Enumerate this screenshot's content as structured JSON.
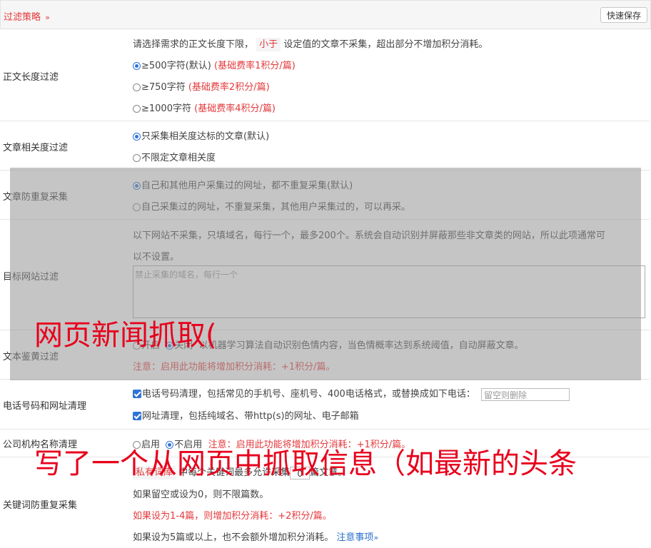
{
  "header": {
    "title": "过滤策略",
    "chevron": "»",
    "save_label": "快速保存"
  },
  "length_filter": {
    "label": "正文长度过滤",
    "desc_before": "请选择需求的正文长度下限，",
    "desc_tag": "小于",
    "desc_after": "设定值的文章不采集，超出部分不增加积分消耗。",
    "options": [
      {
        "label": "≥500字符(默认)",
        "note": "(基础费率1积分/篇)",
        "selected": true
      },
      {
        "label": "≥750字符",
        "note": "(基础费率2积分/篇)",
        "selected": false
      },
      {
        "label": "≥1000字符",
        "note": "(基础费率4积分/篇)",
        "selected": false
      }
    ]
  },
  "relevance_filter": {
    "label": "文章相关度过滤",
    "options": [
      {
        "label": "只采集相关度达标的文章(默认)",
        "selected": true
      },
      {
        "label": "不限定文章相关度",
        "selected": false
      }
    ]
  },
  "dedupe": {
    "label": "文章防重复采集",
    "options": [
      {
        "label": "自己和其他用户采集过的网址，都不重复采集(默认)",
        "selected": true
      },
      {
        "label": "自己采集过的网址，不重复采集，其他用户采集过的，可以再采。",
        "selected": false
      }
    ]
  },
  "site_filter": {
    "label": "目标网站过滤",
    "desc_line1": "以下网站不采集，只填域名，每行一个，最多200个。系统会自动识别并屏蔽那些非文章类的网站，所以此项通常可",
    "desc_line2": "以不设置。",
    "placeholder": "禁止采集的域名，每行一个"
  },
  "porn_filter": {
    "label": "文本鉴黄过滤",
    "on_label": "开启",
    "off_label": "关闭",
    "desc": "以机器学习算法自动识别色情内容，当色情概率达到系统阈值，自动屏蔽文章。",
    "note": "注意：启用此功能将增加积分消耗：+1积分/篇。"
  },
  "contact_clean": {
    "label": "电话号码和网址清理",
    "phone_label": "电话号码清理，包括常见的手机号、座机号、400电话格式，或替换成如下电话：",
    "phone_placeholder": "留空则删除",
    "url_label": "网址清理，包括纯域名、带http(s)的网址、电子邮箱"
  },
  "company_clean": {
    "label": "公司机构名称清理",
    "on_label": "启用",
    "off_label": "不启用",
    "note": "注意：启用此功能将增加积分消耗：+1积分/篇。"
  },
  "keyword_dedupe": {
    "label": "关键词防重复采集",
    "line1_tag": "私有词库",
    "line1_before": "中每个关键词最多允许采集",
    "line1_value": "0",
    "line1_after": "篇文章。",
    "line2": "如果留空或设为0，则不限篇数。",
    "line3": "如果设为1-4篇，则增加积分消耗：+2积分/篇。",
    "line4": "如果设为5篇或以上，也不会额外增加积分消耗。",
    "link": "注意事项",
    "link_chevron": "»"
  },
  "overlay_text": {
    "line1": "网页新闻抓取(",
    "line2": "写了一个从网页中抓取信息（如最新的头条"
  },
  "colors": {
    "accent_red": "#e4393c",
    "radio_blue": "#2f73d9",
    "overlay_red": "#e8001c"
  }
}
